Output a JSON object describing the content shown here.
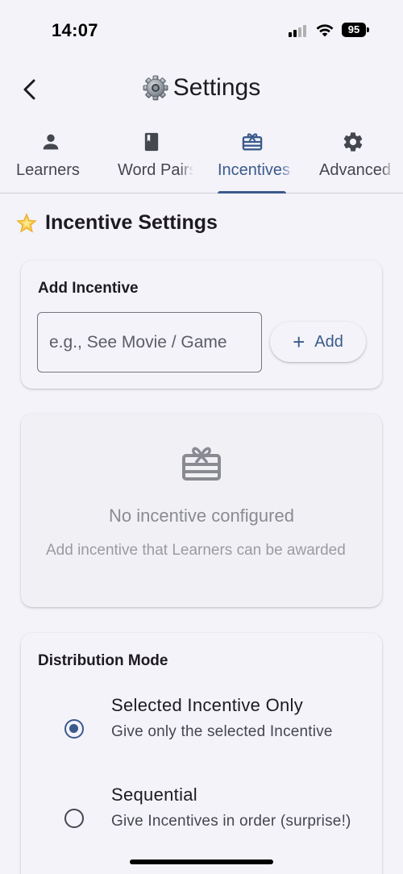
{
  "status_bar": {
    "time": "14:07",
    "battery": "95"
  },
  "app_bar": {
    "title": "Settings",
    "title_icon": "gear-emoji",
    "back_icon": "chevron-left-icon"
  },
  "tabs": [
    {
      "label": "Learners",
      "icon": "person-icon",
      "active": false
    },
    {
      "label": "Word Pairs",
      "icon": "book-icon",
      "active": false
    },
    {
      "label": "Incentives",
      "icon": "gift-card-icon",
      "active": true
    },
    {
      "label": "Advanced",
      "icon": "gear-icon",
      "active": false
    }
  ],
  "section": {
    "title": "Incentive Settings",
    "icon": "star-emoji"
  },
  "add_card": {
    "title": "Add Incentive",
    "input_placeholder": "e.g., See Movie / Game",
    "input_value": "",
    "add_label": "Add",
    "add_icon": "+"
  },
  "empty_card": {
    "icon": "gift-card-icon",
    "title": "No incentive configured",
    "description": "Add incentive that Learners can be awarded"
  },
  "distribution": {
    "title": "Distribution Mode",
    "options": [
      {
        "title": "Selected Incentive Only",
        "description": "Give only the selected Incentive",
        "selected": true
      },
      {
        "title": "Sequential",
        "description": "Give Incentives in order (surprise!)",
        "selected": false
      }
    ]
  },
  "colors": {
    "accent": "#3a5a8c",
    "background": "#f4f3f9",
    "text": "#1d1b20",
    "muted": "#8a8b92"
  }
}
